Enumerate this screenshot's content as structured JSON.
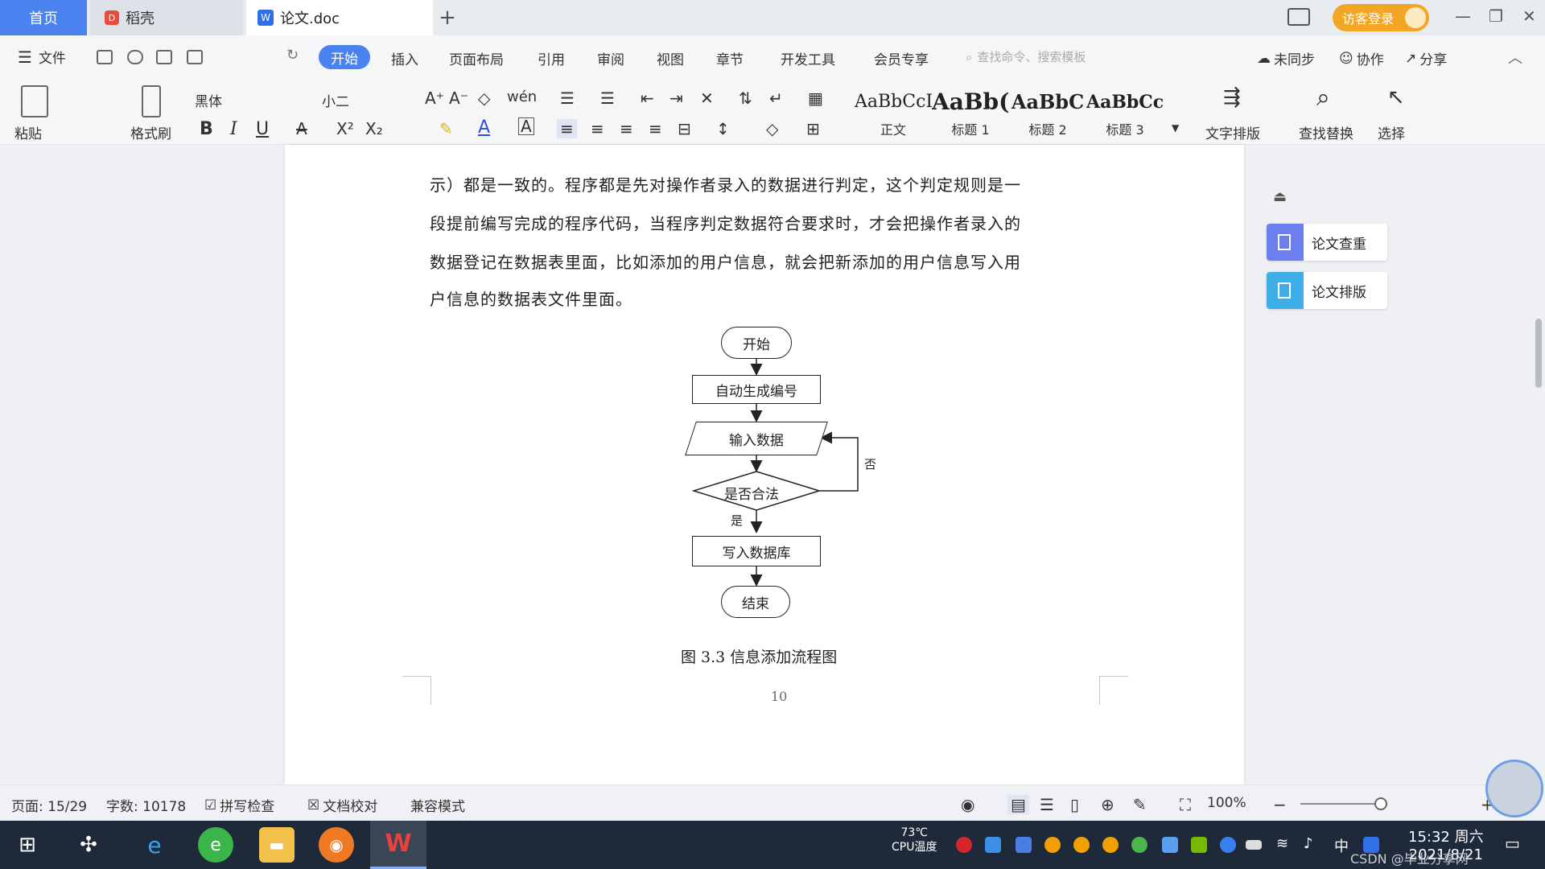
{
  "tabs": {
    "home": "首页",
    "daoke": "稻壳",
    "doc": "论文.doc",
    "add": "+"
  },
  "login": {
    "label": "访客登录"
  },
  "menu": {
    "file": "文件",
    "items": [
      "开始",
      "插入",
      "页面布局",
      "引用",
      "审阅",
      "视图",
      "章节",
      "开发工具",
      "会员专享"
    ],
    "search_cmd": "查找命令、搜索模板",
    "unsynced": "未同步",
    "collab": "协作",
    "share": "分享"
  },
  "ribbon": {
    "paste": "粘贴",
    "format_painter": "格式刷",
    "font_name": "黑体",
    "font_size": "小二",
    "styles": [
      {
        "sample": "AaBbCcI",
        "label": "正文"
      },
      {
        "sample": "AaBb(",
        "label": "标题 1"
      },
      {
        "sample": "AaBbC",
        "label": "标题 2"
      },
      {
        "sample": "AaBbCcI",
        "label": "标题 3"
      }
    ],
    "text_layout": "文字排版",
    "find_replace": "查找替换",
    "select": "选择"
  },
  "document": {
    "paragraphs": [
      "示）都是一致的。程序都是先对操作者录入的数据进行判定，这个判定规则是一",
      "段提前编写完成的程序代码，当程序判定数据符合要求时，才会把操作者录入的",
      "数据登记在数据表里面，比如添加的用户信息，就会把新添加的用户信息写入用",
      "户信息的数据表文件里面。"
    ],
    "flowchart": {
      "start": "开始",
      "auto_number": "自动生成编号",
      "input": "输入数据",
      "decision": "是否合法",
      "write_db": "写入数据库",
      "end": "结束",
      "yes": "是",
      "no": "否"
    },
    "caption": "图 3.3  信息添加流程图",
    "page_number": "10"
  },
  "side_panel": {
    "check": "论文查重",
    "layout": "论文排版"
  },
  "statusbar": {
    "page": "页面: 15/29",
    "words": "字数: 10178",
    "spellcheck": "拼写检查",
    "proofread": "文档校对",
    "compat": "兼容模式",
    "zoom": "100%"
  },
  "taskbar": {
    "cpu_temp": "73℃",
    "cpu_label": "CPU温度",
    "ime": "中",
    "time": "15:32 周六",
    "date": "2021/8/21",
    "watermark": "CSDN @毕业分享网"
  },
  "colors": {
    "accent": "#4a82f0",
    "login": "#f3a624",
    "taskbar": "#1e2a3a"
  }
}
